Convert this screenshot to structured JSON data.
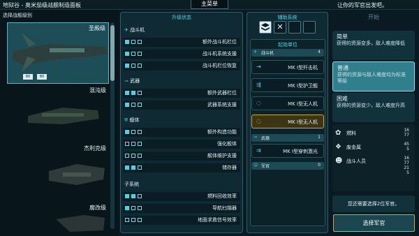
{
  "header": {
    "title": "地狱谷 - 奥米茄级战舰制造面板",
    "main_menu": "主菜单",
    "hint": "让你的军官出发吧。"
  },
  "left_panel": {
    "label": "选择战舰级别",
    "ships": [
      {
        "name": "圣殿级",
        "selected": true,
        "stats": [
          "80",
          "80"
        ]
      },
      {
        "name": "混沌级",
        "selected": false
      },
      {
        "name": "杰利克级",
        "selected": false
      },
      {
        "name": "腐改级",
        "selected": false
      }
    ]
  },
  "upgrade": {
    "title": "升级状态",
    "sections": [
      {
        "name": "战斗机",
        "rows": [
          {
            "label": "额外战斗机栏位",
            "filled": 1
          },
          {
            "label": "战斗机系统支援",
            "filled": 1
          },
          {
            "label": "战斗机栏位恢复",
            "filled": 1
          }
        ]
      },
      {
        "name": "武器",
        "rows": [
          {
            "label": "额外武器栏位",
            "filled": 2
          },
          {
            "label": "武器系统支援",
            "filled": 1
          }
        ]
      },
      {
        "name": "舰体",
        "rows": [
          {
            "label": "额外构造功能",
            "filled": 1
          },
          {
            "label": "强化舰体",
            "filled": 0
          },
          {
            "label": "舰体维护支援",
            "filled": 0
          },
          {
            "label": "储存器",
            "filled": 2
          }
        ]
      },
      {
        "name": "子系统",
        "rows": [
          {
            "label": "燃料回收效率",
            "filled": 2
          },
          {
            "label": "导航扫描器",
            "filled": 1
          },
          {
            "label": "地面求救信号效率",
            "filled": 0
          }
        ]
      }
    ]
  },
  "aux": {
    "title": "辅助系统",
    "units_title": "起始单位",
    "fighter_cat": {
      "label": "战斗机",
      "count": "4"
    },
    "units": [
      {
        "label": "MK I型歼击机"
      },
      {
        "label": "MK I型护卫舰"
      },
      {
        "label": "MK I型无人机"
      },
      {
        "label": "MK I型无人机",
        "highlight": true
      }
    ],
    "weapon_cat": {
      "label": "武器",
      "count": "1"
    },
    "weapon": {
      "label": "MK I型穿刺激光"
    },
    "officer_cat": {
      "label": "军官",
      "count": "0"
    }
  },
  "right_panel": {
    "start": "开始",
    "difficulty": [
      {
        "title": "简单",
        "desc": "获得的资源变多，敌人难度降低"
      },
      {
        "title": "普通",
        "desc": "获得的资源与敌人难度均为标准等级",
        "selected": true
      },
      {
        "title": "困难",
        "desc": "获得的资源变少，敌人难度升高"
      }
    ],
    "resources": [
      {
        "label": "燃料",
        "values": [
          "16",
          "77"
        ]
      },
      {
        "label": "废金属",
        "values": [
          "45",
          "5"
        ]
      },
      {
        "label": "战斗人员",
        "values": [
          "16",
          "77",
          "21",
          "5"
        ]
      }
    ],
    "notice": "您还需要选择2位军官。",
    "button": "选择军官"
  },
  "colors": {
    "accent": "#45d6e6",
    "button_border": "#d5a53a",
    "selected": "#2f7f8d"
  }
}
